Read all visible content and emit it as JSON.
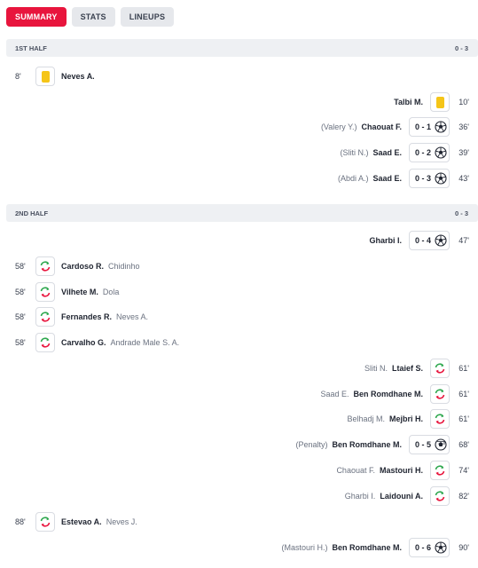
{
  "tabs": [
    {
      "label": "SUMMARY",
      "active": true
    },
    {
      "label": "STATS",
      "active": false
    },
    {
      "label": "LINEUPS",
      "active": false
    }
  ],
  "halves": [
    {
      "label": "1ST HALF",
      "score": "0 - 3"
    },
    {
      "label": "2ND HALF",
      "score": "0 - 3"
    }
  ],
  "events": [
    {
      "side": "home",
      "minute": "8'",
      "type": "yellow-card",
      "player": "Neves A.",
      "detail": ""
    },
    {
      "side": "away",
      "minute": "10'",
      "type": "yellow-card",
      "player": "Talbi M.",
      "detail": ""
    },
    {
      "side": "away",
      "minute": "36'",
      "type": "goal",
      "player": "Chaouat F.",
      "detail": "(Valery Y.)",
      "score": "0 - 1"
    },
    {
      "side": "away",
      "minute": "39'",
      "type": "goal",
      "player": "Saad E.",
      "detail": "(Sliti N.)",
      "score": "0 - 2"
    },
    {
      "side": "away",
      "minute": "43'",
      "type": "goal",
      "player": "Saad E.",
      "detail": "(Abdi A.)",
      "score": "0 - 3"
    },
    {
      "side": "away",
      "minute": "47'",
      "type": "goal",
      "player": "Gharbi I.",
      "detail": "",
      "score": "0 - 4"
    },
    {
      "side": "home",
      "minute": "58'",
      "type": "substitution",
      "player": "Cardoso R.",
      "detail": "Chidinho"
    },
    {
      "side": "home",
      "minute": "58'",
      "type": "substitution",
      "player": "Vilhete M.",
      "detail": "Dola"
    },
    {
      "side": "home",
      "minute": "58'",
      "type": "substitution",
      "player": "Fernandes R.",
      "detail": "Neves A."
    },
    {
      "side": "home",
      "minute": "58'",
      "type": "substitution",
      "player": "Carvalho G.",
      "detail": "Andrade Male S. A."
    },
    {
      "side": "away",
      "minute": "61'",
      "type": "substitution",
      "player": "Ltaief S.",
      "detail": "Sliti N."
    },
    {
      "side": "away",
      "minute": "61'",
      "type": "substitution",
      "player": "Ben Romdhane M.",
      "detail": "Saad E."
    },
    {
      "side": "away",
      "minute": "61'",
      "type": "substitution",
      "player": "Mejbri H.",
      "detail": "Belhadj M."
    },
    {
      "side": "away",
      "minute": "68'",
      "type": "penalty",
      "player": "Ben Romdhane M.",
      "detail": "(Penalty)",
      "score": "0 - 5"
    },
    {
      "side": "away",
      "minute": "74'",
      "type": "substitution",
      "player": "Mastouri H.",
      "detail": "Chaouat F."
    },
    {
      "side": "away",
      "minute": "82'",
      "type": "substitution",
      "player": "Laidouni A.",
      "detail": "Gharbi I."
    },
    {
      "side": "home",
      "minute": "88'",
      "type": "substitution",
      "player": "Estevao A.",
      "detail": "Neves J."
    },
    {
      "side": "away",
      "minute": "90'",
      "type": "goal",
      "player": "Ben Romdhane M.",
      "detail": "(Mastouri H.)",
      "score": "0 - 6"
    }
  ]
}
